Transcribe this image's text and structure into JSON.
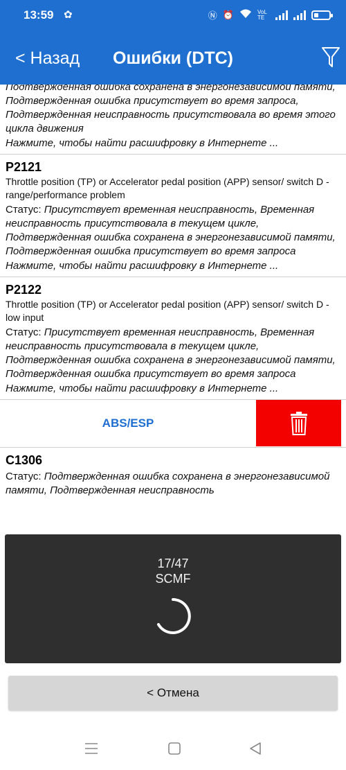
{
  "status_bar": {
    "time": "13:59",
    "network_label": "VoLTE"
  },
  "header": {
    "back_label": "< Назад",
    "title": "Ошибки (DTC)"
  },
  "partial_entry": {
    "status_text": "Подтвержденная ошибка сохранена в энергонезависимой памяти, Подтвержденная ошибка присутствует во время запроса, Подтвержденная неисправность присутствовала во время этого цикла движения",
    "link": "Нажмите, чтобы найти расшифровку в Интернете ..."
  },
  "entries": [
    {
      "code": "P2121",
      "description": "Throttle position (TP) or Accelerator pedal position (APP) sensor/ switch D - range/performance problem",
      "status_label": "Статус:",
      "status_text": "Присутствует временная неисправность, Временная неисправность присутствовала в текущем цикле, Подтвержденная ошибка сохранена в энергонезависимой памяти, Подтвержденная ошибка присутствует во время запроса",
      "link": "Нажмите, чтобы найти расшифровку в Интернете ..."
    },
    {
      "code": "P2122",
      "description": "Throttle position (TP) or Accelerator pedal position (APP) sensor/ switch D - low input",
      "status_label": "Статус:",
      "status_text": "Присутствует временная неисправность, Временная неисправность присутствовала в текущем цикле, Подтвержденная ошибка сохранена в энергонезависимой памяти, Подтвержденная ошибка присутствует во время запроса",
      "link": "Нажмите, чтобы найти расшифровку в Интернете ..."
    }
  ],
  "section": {
    "label": "ABS/ESP"
  },
  "next_entry": {
    "code": "C1306",
    "status_label": "Статус:",
    "status_text": "Подтвержденная ошибка сохранена в энергонезависимой памяти, Подтвержденная неисправность"
  },
  "progress": {
    "count": "17/47",
    "name": "SCMF"
  },
  "cancel_label": "< Отмена",
  "colors": {
    "accent": "#1f6fd1",
    "danger": "#f30000",
    "dialog": "#2f2f2f"
  }
}
